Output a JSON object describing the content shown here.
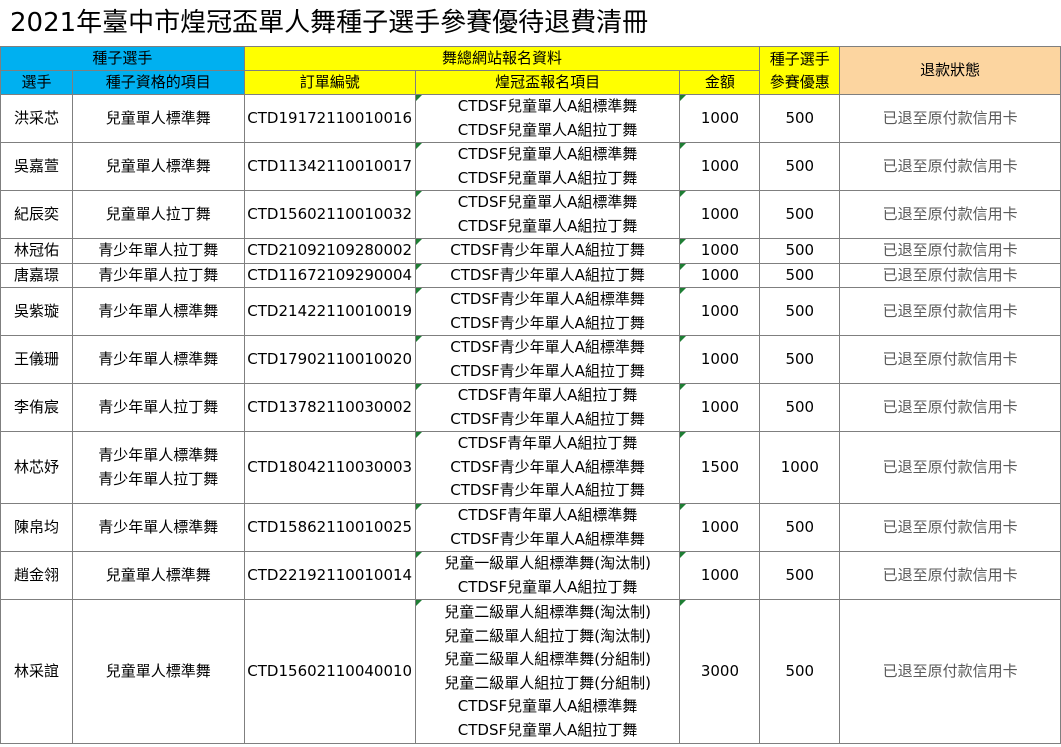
{
  "title": "2021年臺中市煌冠盃單人舞種子選手參賽優待退費清冊",
  "header": {
    "seed_group": "種子選手",
    "site_group": "舞總網站報名資料",
    "seed_discount": [
      "種子選手",
      "參賽優惠"
    ],
    "refund_status": "退款狀態",
    "player": "選手",
    "seed_item": "種子資格的項目",
    "order_no": "訂單編號",
    "reg_item": "煌冠盃報名項目",
    "amount": "金額"
  },
  "rows": [
    {
      "player": "洪采芯",
      "seed_items": [
        "兒童單人標準舞"
      ],
      "order": "CTD19172110010016",
      "reg_items": [
        "CTDSF兒童單人A組標準舞",
        "CTDSF兒童單人A組拉丁舞"
      ],
      "amount": "1000",
      "discount": "500",
      "status": "已退至原付款信用卡"
    },
    {
      "player": "吳嘉萱",
      "seed_items": [
        "兒童單人標準舞"
      ],
      "order": "CTD11342110010017",
      "reg_items": [
        "CTDSF兒童單人A組標準舞",
        "CTDSF兒童單人A組拉丁舞"
      ],
      "amount": "1000",
      "discount": "500",
      "status": "已退至原付款信用卡"
    },
    {
      "player": "紀辰奕",
      "seed_items": [
        "兒童單人拉丁舞"
      ],
      "order": "CTD15602110010032",
      "reg_items": [
        "CTDSF兒童單人A組標準舞",
        "CTDSF兒童單人A組拉丁舞"
      ],
      "amount": "1000",
      "discount": "500",
      "status": "已退至原付款信用卡"
    },
    {
      "player": "林冠佑",
      "seed_items": [
        "青少年單人拉丁舞"
      ],
      "order": "CTD21092109280002",
      "reg_items": [
        "CTDSF青少年單人A組拉丁舞"
      ],
      "amount": "1000",
      "discount": "500",
      "status": "已退至原付款信用卡"
    },
    {
      "player": "唐嘉璟",
      "seed_items": [
        "青少年單人拉丁舞"
      ],
      "order": "CTD11672109290004",
      "reg_items": [
        "CTDSF青少年單人A組拉丁舞"
      ],
      "amount": "1000",
      "discount": "500",
      "status": "已退至原付款信用卡"
    },
    {
      "player": "吳紫璇",
      "seed_items": [
        "青少年單人標準舞"
      ],
      "order": "CTD21422110010019",
      "reg_items": [
        "CTDSF青少年單人A組標準舞",
        "CTDSF青少年單人A組拉丁舞"
      ],
      "amount": "1000",
      "discount": "500",
      "status": "已退至原付款信用卡"
    },
    {
      "player": "王儀珊",
      "seed_items": [
        "青少年單人標準舞"
      ],
      "order": "CTD17902110010020",
      "reg_items": [
        "CTDSF青少年單人A組標準舞",
        "CTDSF青少年單人A組拉丁舞"
      ],
      "amount": "1000",
      "discount": "500",
      "status": "已退至原付款信用卡"
    },
    {
      "player": "李侑宸",
      "seed_items": [
        "青少年單人拉丁舞"
      ],
      "order": "CTD13782110030002",
      "reg_items": [
        "CTDSF青年單人A組拉丁舞",
        "CTDSF青少年單人A組拉丁舞"
      ],
      "amount": "1000",
      "discount": "500",
      "status": "已退至原付款信用卡"
    },
    {
      "player": "林芯妤",
      "seed_items": [
        "青少年單人標準舞",
        "青少年單人拉丁舞"
      ],
      "order": "CTD18042110030003",
      "reg_items": [
        "CTDSF青年單人A組拉丁舞",
        "CTDSF青少年單人A組標準舞",
        "CTDSF青少年單人A組拉丁舞"
      ],
      "amount": "1500",
      "discount": "1000",
      "status": "已退至原付款信用卡"
    },
    {
      "player": "陳帛均",
      "seed_items": [
        "青少年單人標準舞"
      ],
      "order": "CTD15862110010025",
      "reg_items": [
        "CTDSF青年單人A組標準舞",
        "CTDSF青少年單人A組標準舞"
      ],
      "amount": "1000",
      "discount": "500",
      "status": "已退至原付款信用卡"
    },
    {
      "player": "趙金翎",
      "seed_items": [
        "兒童單人標準舞"
      ],
      "order": "CTD22192110010014",
      "reg_items": [
        "兒童一級單人組標準舞(淘汰制)",
        "CTDSF兒童單人A組拉丁舞"
      ],
      "amount": "1000",
      "discount": "500",
      "status": "已退至原付款信用卡"
    },
    {
      "player": "林采誼",
      "seed_items": [
        "兒童單人標準舞"
      ],
      "order": "CTD15602110040010",
      "reg_items": [
        "兒童二級單人組標準舞(淘汰制)",
        "兒童二級單人組拉丁舞(淘汰制)",
        "兒童二級單人組標準舞(分組制)",
        "兒童二級單人組拉丁舞(分組制)",
        "CTDSF兒童單人A組標準舞",
        "CTDSF兒童單人A組拉丁舞"
      ],
      "amount": "3000",
      "discount": "500",
      "status": "已退至原付款信用卡"
    }
  ]
}
